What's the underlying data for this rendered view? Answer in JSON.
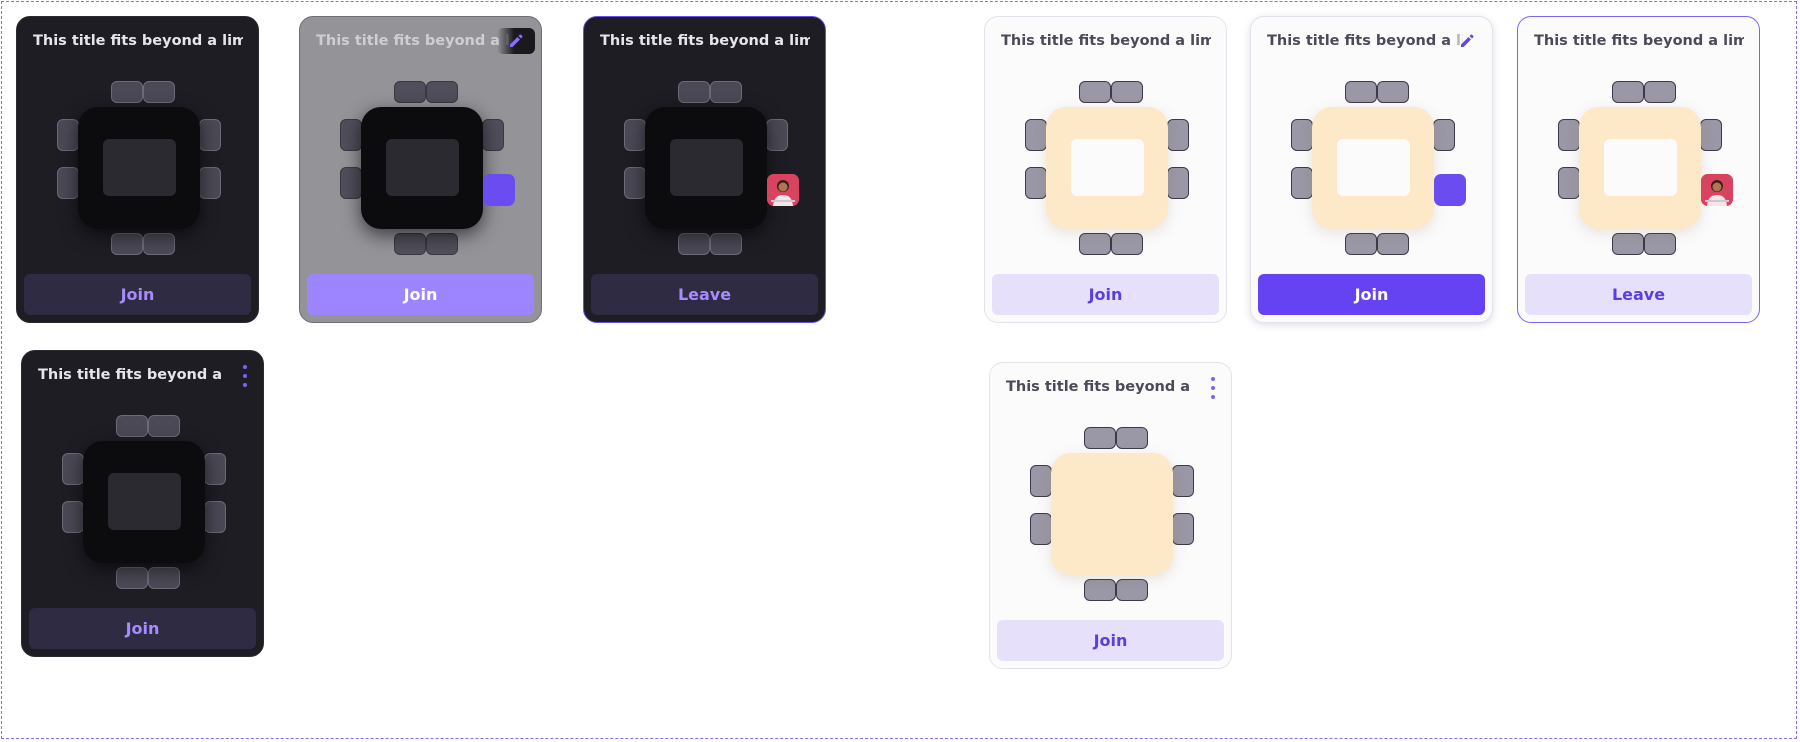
{
  "cards": [
    {
      "title": "This title fits beyond a limitation",
      "button": "Join"
    },
    {
      "title": "This title fits beyond a limitation",
      "button": "Join",
      "edit_icon": "pencil-icon"
    },
    {
      "title": "This title fits beyond a limitation",
      "button": "Leave",
      "avatar": "user-avatar"
    },
    {
      "title": "This title fits beyond a limitation",
      "button": "Join",
      "menu_icon": "kebab-menu-icon"
    },
    {
      "title": "This title fits beyond a limitation",
      "button": "Join"
    },
    {
      "title": "This title fits beyond a limitation",
      "button": "Join",
      "edit_icon": "pencil-icon"
    },
    {
      "title": "This title fits beyond a limitation",
      "button": "Leave",
      "avatar": "user-avatar"
    },
    {
      "title": "This title fits beyond a limitation",
      "button": "Join",
      "menu_icon": "kebab-menu-icon"
    }
  ],
  "colors": {
    "accent": "#6543f3",
    "dark_card": "#1e1d24",
    "light_card": "#fbfbfc",
    "table_light": "#fde8c8",
    "table_dark": "#0c0c0f"
  }
}
